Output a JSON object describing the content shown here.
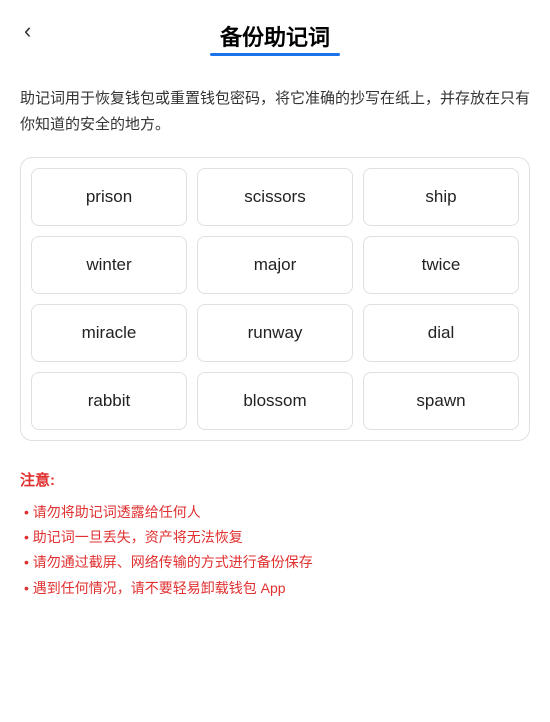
{
  "header": {
    "back_icon": "‹",
    "title": "备份助记词"
  },
  "description": "助记词用于恢复钱包或重置钱包密码，将它准确的抄写在纸上，并存放在只有你知道的安全的地方。",
  "words": [
    {
      "id": 1,
      "word": "prison"
    },
    {
      "id": 2,
      "word": "scissors"
    },
    {
      "id": 3,
      "word": "ship"
    },
    {
      "id": 4,
      "word": "winter"
    },
    {
      "id": 5,
      "word": "major"
    },
    {
      "id": 6,
      "word": "twice"
    },
    {
      "id": 7,
      "word": "miracle"
    },
    {
      "id": 8,
      "word": "runway"
    },
    {
      "id": 9,
      "word": "dial"
    },
    {
      "id": 10,
      "word": "rabbit"
    },
    {
      "id": 11,
      "word": "blossom"
    },
    {
      "id": 12,
      "word": "spawn"
    }
  ],
  "notice": {
    "title": "注意:",
    "items": [
      "请勿将助记词透露给任何人",
      "助记词一旦丢失，资产将无法恢复",
      "请勿通过截屏、网络传输的方式进行备份保存",
      "遇到任何情况，请不要轻易卸载钱包 App"
    ]
  }
}
